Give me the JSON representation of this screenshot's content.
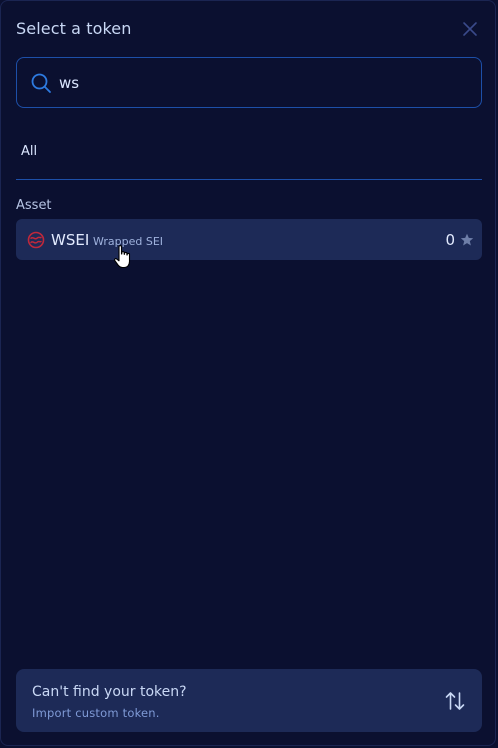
{
  "modal": {
    "title": "Select a token",
    "close_icon": "close-icon"
  },
  "search": {
    "value": "ws",
    "icon": "search-icon"
  },
  "tabs": [
    {
      "label": "All",
      "active": true
    }
  ],
  "section": {
    "label": "Asset"
  },
  "tokens": [
    {
      "symbol": "WSEI",
      "name": "Wrapped SEI",
      "balance": "0",
      "logo_icon": "sei-logo-icon",
      "favorite_icon": "star-icon",
      "favorited": false
    }
  ],
  "import": {
    "title": "Can't find your token?",
    "subtitle": "Import custom token.",
    "icon": "swap-arrows-icon"
  },
  "colors": {
    "background": "#0b1030",
    "accent_border": "#1d4fa8",
    "row_bg": "#1d2a57",
    "logo_red": "#c0283b"
  }
}
